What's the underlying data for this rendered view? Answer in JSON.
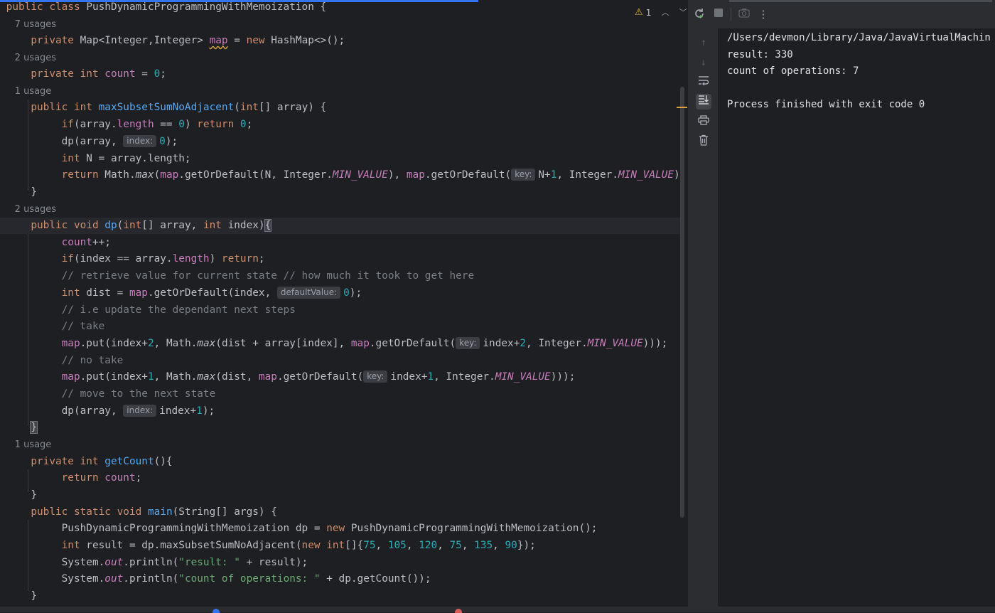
{
  "editor": {
    "inlays": {
      "usages7": "7 usages",
      "usages2a": "2 usages",
      "usage1a": "1 usage",
      "usages2b": "2 usages",
      "usage1b": "1 usage"
    },
    "hints": {
      "index": "index:",
      "key": "key:",
      "defaultValue": "defaultValue:"
    },
    "warning_count": "1",
    "code": {
      "class_name": "PushDynamicProgrammingWithMemoization",
      "map_field": "map",
      "count_field": "count",
      "method_maxSubset": "maxSubsetSumNoAdjacent",
      "method_dp": "dp",
      "method_getCount": "getCount",
      "method_main": "main",
      "cmt1": "// retrieve value for current state // how much it took to get here",
      "cmt2": "// i.e update the dependant next steps",
      "cmt3": "// take",
      "cmt4": "// no take",
      "cmt5": "// move to the next state",
      "str_result": "\"result: \"",
      "str_count": "\"count of operations: \""
    }
  },
  "run": {
    "console": [
      "/Users/devmon/Library/Java/JavaVirtualMachin",
      "result: 330",
      "count of operations: 7",
      "",
      "Process finished with exit code 0"
    ],
    "toolbar_icons": [
      "rerun-icon",
      "stop-icon",
      "camera-icon",
      "more-icon"
    ],
    "side_icons": [
      "up-arrow-icon",
      "down-arrow-icon",
      "soft-wrap-icon",
      "scroll-to-end-icon",
      "print-icon",
      "trash-icon"
    ]
  },
  "colors": {
    "keyword": "#cf8e6d",
    "field": "#c77dbb",
    "number": "#2aacb8",
    "function": "#56a8f5",
    "string": "#6aab73",
    "comment": "#7a7e85"
  }
}
